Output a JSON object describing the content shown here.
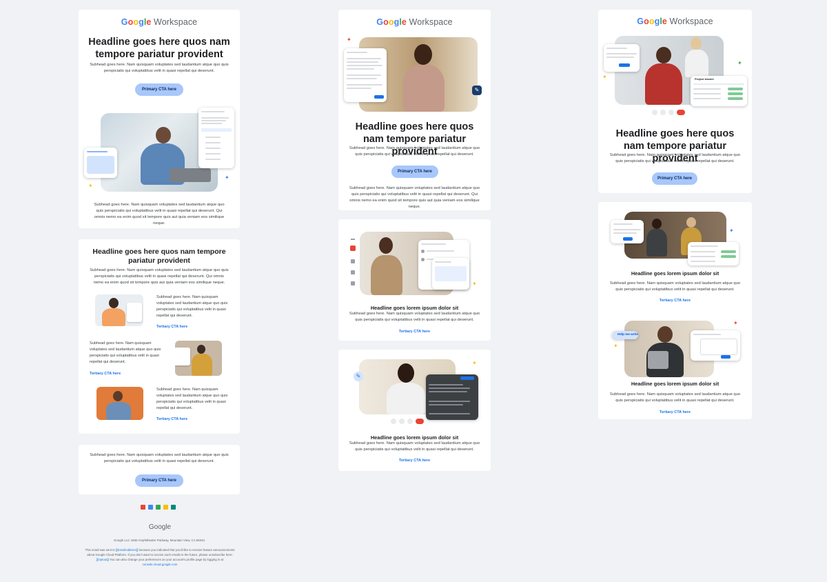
{
  "brand": {
    "google": [
      "G",
      "o",
      "o",
      "g",
      "l",
      "e"
    ],
    "workspace": "Workspace",
    "footer_logo": "Google"
  },
  "col1": {
    "hero": {
      "headline": "Headline goes here quos nam tempore pariatur provident",
      "subhead": "Subhead goes here. Nam quisquam voluptates sed laudantium atque quo quis perspiciatis qui voluptatibus velit in quasi repellat qui deserunt.",
      "cta": "Primary CTA here",
      "body": "Subhead goes here. Nam quisquam voluptates sed laudantium atque quo quis perspiciatis qui voluptatibus velit in quasi repellat qui deserunt. Qui omnis nemo ea enim quod sit tempore quis aut quia veniam eos similique neque."
    },
    "section": {
      "headline": "Headline goes here quos nam tempore pariatur provident",
      "subhead": "Subhead goes here. Nam quisquam voluptates sed laudantium atque quo quis perspiciatis qui voluptatibus velit in quasi repellat qui deserunt. Qui omnis nemo ea enim quod sit tempore quis aut quia veniam eos similique neque.",
      "rows": [
        {
          "text": "Subhead goes here. Nam quisquam voluptates sed laudantium atque quo quis perspiciatis qui voluptatibus velit in quasi repellat qui deserunt.",
          "cta": "Tertiary CTA here"
        },
        {
          "text": "Subhead goes here. Nam quisquam voluptates sed laudantium atque quo quis perspiciatis qui voluptatibus velit in quasi repellat qui deserunt.",
          "cta": "Tertiary CTA here"
        },
        {
          "text": "Subhead goes here. Nam quisquam voluptates sed laudantium atque quo quis perspiciatis qui voluptatibus velit in quasi repellat qui deserunt.",
          "cta": "Tertiary CTA here"
        }
      ]
    },
    "closing": {
      "subhead": "Subhead goes here. Nam quisquam voluptates sed laudantium atque quo quis perspiciatis qui voluptatibus velit in quasi repellat qui deserunt.",
      "cta": "Primary CTA here"
    },
    "footer": {
      "address": "Google LLC 1600 Amphitheatre Parkway, Mountain View, CA 94043",
      "legal_pre": "This email was sent to",
      "email_token": "[[EmailAddress]]",
      "legal_mid": "because you indicated that you'd like to receive feature announcements about Google Cloud Platform. If you don't want to receive such emails in the future, please unsubscribe here:",
      "unsub_token": "[[Optout]]",
      "legal_post": "You can also change your preferences on your account's profile page by logging in at",
      "site": "console.cloud.google.com",
      "app_icons": [
        "gmail-icon",
        "calendar-icon",
        "drive-icon",
        "docs-icon",
        "meet-icon"
      ]
    }
  },
  "col2": {
    "hero": {
      "headline": "Headline goes here quos nam tempore pariatur provident",
      "subhead": "Subhead goes here. Nam quisquam voluptates sed laudantium atque quo quis perspiciatis qui voluptatibus velit in quasi repellat qui deserunt.",
      "cta": "Primary CTA here",
      "body": "Subhead goes here. Nam quisquam voluptates sed laudantium atque quo quis perspiciatis qui voluptatibus velit in quasi repellat qui deserunt. Qui omnis nemo ea enim quod sit tempore quis aut quia veniam eos similique neque."
    },
    "feature1": {
      "headline": "Headline goes lorem ipsum dolor sit",
      "subhead": "Subhead goes here. Nam quisquam voluptates sed laudantium atque quo quis perspiciatis qui voluptatibus velit in quasi repellat qui deserunt.",
      "cta": "Tertiary CTA here"
    },
    "feature2": {
      "headline": "Headline goes lorem ipsum dolor sit",
      "subhead": "Subhead goes here. Nam quisquam voluptates sed laudantium atque quo quis perspiciatis qui voluptatibus velit in quasi repellat qui deserunt.",
      "cta": "Tertiary CTA here"
    }
  },
  "col3": {
    "hero": {
      "headline": "Headline goes here quos nam tempore pariatur provident",
      "subhead": "Subhead goes here. Nam quisquam voluptates sed laudantium atque quo quis perspiciatis qui voluptatibus velit in quasi repellat qui deserunt.",
      "cta": "Primary CTA here",
      "panel_title": "Project tracker"
    },
    "feature1": {
      "headline": "Headline goes lorem ipsum dolor sit",
      "subhead": "Subhead goes here. Nam quisquam voluptates sed laudantium atque quo quis perspiciatis qui voluptatibus velit in quasi repellat qui deserunt.",
      "cta": "Tertiary CTA here"
    },
    "feature2": {
      "headline": "Headline goes lorem ipsum dolor sit",
      "subhead": "Subhead goes here. Nam quisquam voluptates sed laudantium atque quo quis perspiciatis qui voluptatibus velit in quasi repellat qui deserunt.",
      "cta": "Tertiary CTA here",
      "chip": "Help me write"
    }
  },
  "colors": {
    "page_bg": "#f0f2f5",
    "cta_bg": "#a8c7fa",
    "link": "#1a73e8",
    "google_blue": "#4285f4",
    "google_red": "#ea4335",
    "google_yellow": "#fbbc04",
    "google_green": "#34a853"
  }
}
